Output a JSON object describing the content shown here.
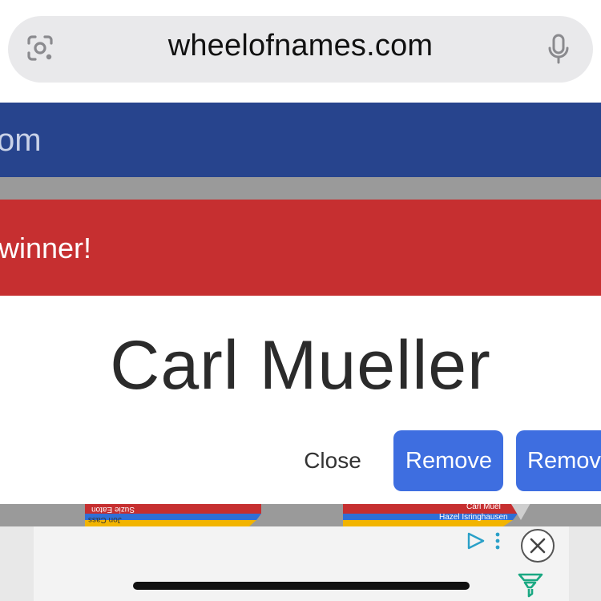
{
  "browser": {
    "url": "wheelofnames.com",
    "lens_icon": "camera-lens-icon",
    "mic_icon": "microphone-icon"
  },
  "site": {
    "banner_text": "om",
    "banner_color": "#27448d"
  },
  "dialog": {
    "header_text": "winner!",
    "header_color": "#c62f30",
    "winner_name": "Carl Mueller",
    "close_label": "Close",
    "remove_label": "Remove",
    "remove_all_label": "Remov",
    "button_color": "#3e6ee0"
  },
  "wheels": {
    "left_labels": [
      "Suzie Eaton",
      "Jon Cass"
    ],
    "right_labels": [
      "Carl Muel",
      "Hazel Isringhausen"
    ]
  },
  "ad": {
    "play_icon": "ad-choices-play-icon",
    "more_icon": "more-vertical-icon",
    "close_icon": "close-icon",
    "brand_icon": "funnel-logo-icon"
  }
}
